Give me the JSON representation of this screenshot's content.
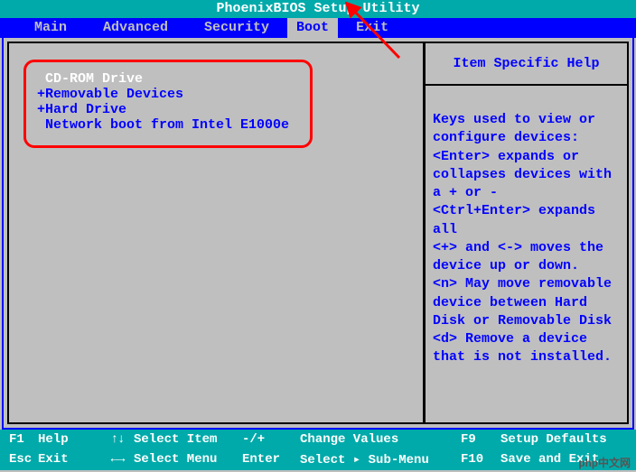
{
  "title": "PhoenixBIOS Setup Utility",
  "menu": {
    "items": [
      "Main",
      "Advanced",
      "Security",
      "Boot",
      "Exit"
    ],
    "active_index": 3
  },
  "boot_list": {
    "items": [
      {
        "label": " CD-ROM Drive",
        "selected": true
      },
      {
        "label": "+Removable Devices",
        "selected": false
      },
      {
        "label": "+Hard Drive",
        "selected": false
      },
      {
        "label": " Network boot from Intel E1000e",
        "selected": false
      }
    ]
  },
  "help": {
    "title": "Item Specific Help",
    "body": "Keys used to view or\nconfigure devices:\n<Enter> expands or\ncollapses devices with\na + or -\n<Ctrl+Enter> expands\nall\n<+> and <-> moves the\ndevice up or down.\n<n> May move removable\ndevice between Hard\nDisk or Removable Disk\n<d> Remove a device\nthat is not installed."
  },
  "footer": {
    "row1": {
      "k1": "F1",
      "l1": "Help",
      "s": "↑↓",
      "a": "Select Item",
      "e": "-/+",
      "m": "Change Values",
      "k2": "F9",
      "r": "Setup Defaults"
    },
    "row2": {
      "k1": "Esc",
      "l1": "Exit",
      "s": "←→",
      "a": "Select Menu",
      "e": "Enter",
      "m": "Select ▸ Sub-Menu",
      "k2": "F10",
      "r": "Save and Exit"
    }
  },
  "watermark": "php中文网"
}
